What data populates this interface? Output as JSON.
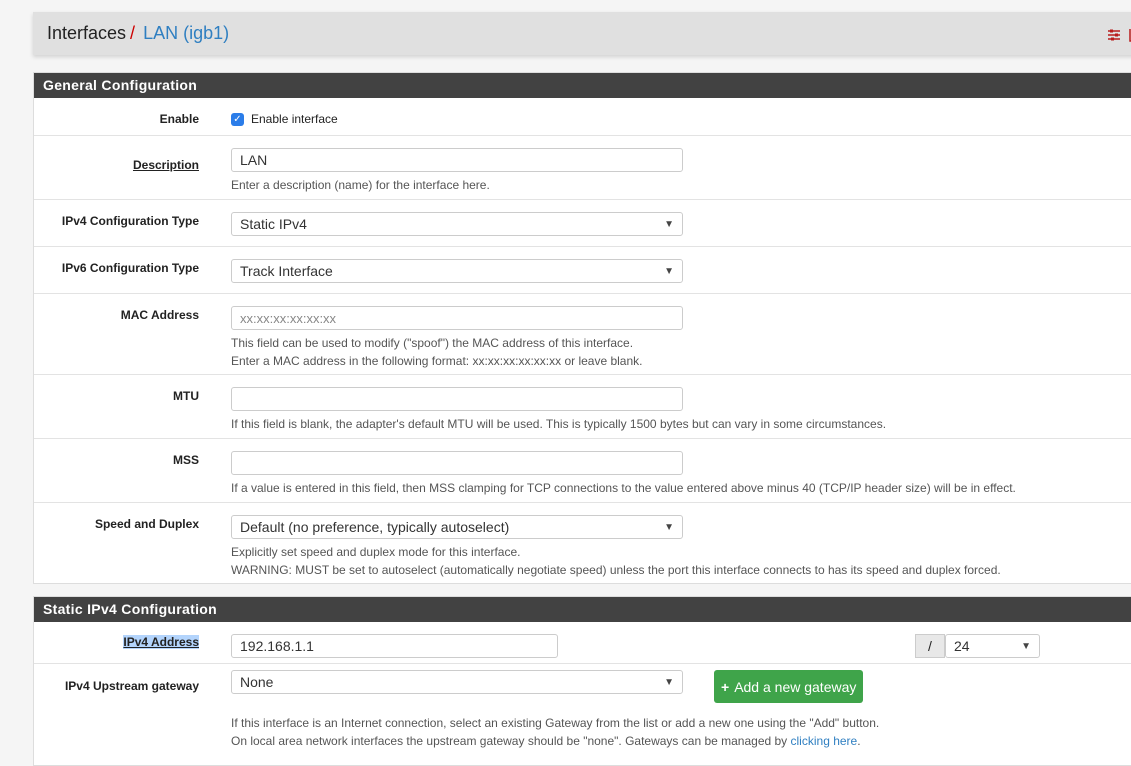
{
  "breadcrumb": {
    "parent": "Interfaces",
    "separator": "/",
    "current": "LAN (igb1)"
  },
  "header_icons": [
    "sliders-icon",
    "bar-chart-icon"
  ],
  "general": {
    "title": "General Configuration",
    "enable": {
      "label": "Enable",
      "checkbox_label": "Enable interface",
      "checked": true
    },
    "description": {
      "label": "Description",
      "value": "LAN",
      "help": "Enter a description (name) for the interface here."
    },
    "ipv4_type": {
      "label": "IPv4 Configuration Type",
      "value": "Static IPv4"
    },
    "ipv6_type": {
      "label": "IPv6 Configuration Type",
      "value": "Track Interface"
    },
    "mac": {
      "label": "MAC Address",
      "placeholder": "xx:xx:xx:xx:xx:xx",
      "help1": "This field can be used to modify (\"spoof\") the MAC address of this interface.",
      "help2": "Enter a MAC address in the following format: xx:xx:xx:xx:xx:xx or leave blank."
    },
    "mtu": {
      "label": "MTU",
      "value": "",
      "help": "If this field is blank, the adapter's default MTU will be used. This is typically 1500 bytes but can vary in some circumstances."
    },
    "mss": {
      "label": "MSS",
      "value": "",
      "help": "If a value is entered in this field, then MSS clamping for TCP connections to the value entered above minus 40 (TCP/IP header size) will be in effect."
    },
    "speed": {
      "label": "Speed and Duplex",
      "value": "Default (no preference, typically autoselect)",
      "help1": "Explicitly set speed and duplex mode for this interface.",
      "help2": "WARNING: MUST be set to autoselect (automatically negotiate speed) unless the port this interface connects to has its speed and duplex forced."
    }
  },
  "static": {
    "title": "Static IPv4 Configuration",
    "address": {
      "label": "IPv4 Address",
      "value": "192.168.1.1",
      "slash": "/",
      "cidr": "24"
    },
    "gateway": {
      "label": "IPv4 Upstream gateway",
      "value": "None",
      "add_button": "Add a new gateway",
      "help1": "If this interface is an Internet connection, select an existing Gateway from the list or add a new one using the \"Add\" button.",
      "help2_prefix": "On local area network interfaces the upstream gateway should be \"none\". Gateways can be managed by ",
      "help2_link": "clicking here",
      "help2_suffix": "."
    }
  },
  "colors": {
    "header_bar": "#424242",
    "link": "#2f7fc1",
    "button_green": "#3fa44a",
    "accent_red": "#b91c1c"
  }
}
